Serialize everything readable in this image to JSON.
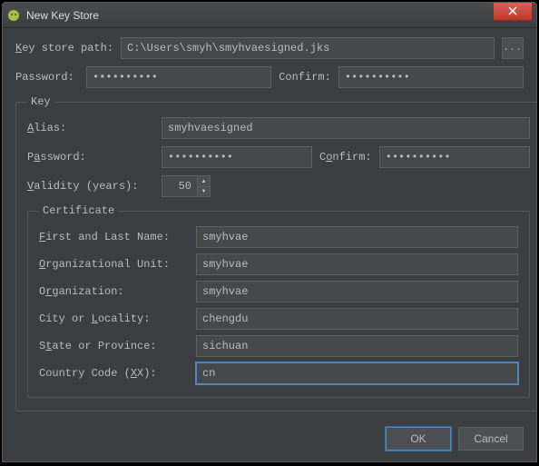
{
  "window": {
    "title": "New Key Store"
  },
  "keystore": {
    "path_label": "Key store path:",
    "path_value": "C:\\Users\\smyh\\smyhvaesigned.jks",
    "browse_label": "...",
    "password_label": "Password:",
    "password_value": "••••••••••",
    "confirm_label": "Confirm:",
    "confirm_value": "••••••••••"
  },
  "key_section": {
    "legend": "Key",
    "alias_label": "Alias:",
    "alias_value": "smyhvaesigned",
    "password_label": "Password:",
    "password_value": "••••••••••",
    "confirm_label": "Confirm:",
    "confirm_value": "••••••••••",
    "validity_label": "Validity (years):",
    "validity_value": "50"
  },
  "certificate": {
    "legend": "Certificate",
    "first_last_label": "First and Last Name:",
    "first_last_value": "smyhvae",
    "org_unit_label": "Organizational Unit:",
    "org_unit_value": "smyhvae",
    "org_label": "Organization:",
    "org_value": "smyhvae",
    "city_label": "City or Locality:",
    "city_value": "chengdu",
    "state_label": "State or Province:",
    "state_value": "sichuan",
    "country_label": "Country Code (XX):",
    "country_value": "cn"
  },
  "buttons": {
    "ok": "OK",
    "cancel": "Cancel"
  }
}
